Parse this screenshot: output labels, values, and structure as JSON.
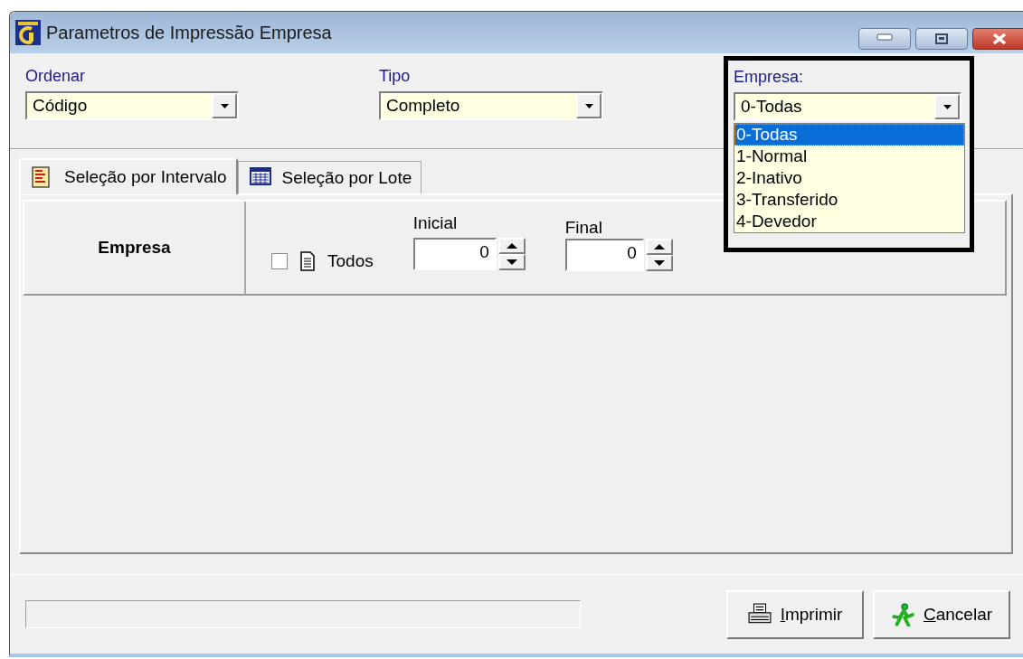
{
  "window": {
    "title": "Parametros de Impressão Empresa"
  },
  "filters": [
    {
      "label": "Ordenar",
      "value": "Código"
    },
    {
      "label": "Tipo",
      "value": "Completo"
    }
  ],
  "empresa_filter": {
    "label": "Empresa:",
    "value": "0-Todas",
    "expanded": true,
    "options": [
      {
        "label": "0-Todas",
        "selected": true
      },
      {
        "label": "1-Normal",
        "selected": false
      },
      {
        "label": "2-Inativo",
        "selected": false
      },
      {
        "label": "3-Transferido",
        "selected": false
      },
      {
        "label": "4-Devedor",
        "selected": false
      }
    ]
  },
  "tabs": [
    {
      "label": "Seleção por Intervalo",
      "selected": true,
      "kind": "list"
    },
    {
      "label": "Seleção por Lote",
      "selected": false,
      "kind": "grid"
    }
  ],
  "range": {
    "field": "Empresa",
    "all": {
      "label": "Todos",
      "checked": false
    },
    "start": {
      "label": "Inicial",
      "value": "0"
    },
    "end": {
      "label": "Final",
      "value": "0"
    }
  },
  "buttons": [
    {
      "label": "Imprimir",
      "kind": "print"
    },
    {
      "label": "Cancelar",
      "kind": "cancel"
    }
  ]
}
